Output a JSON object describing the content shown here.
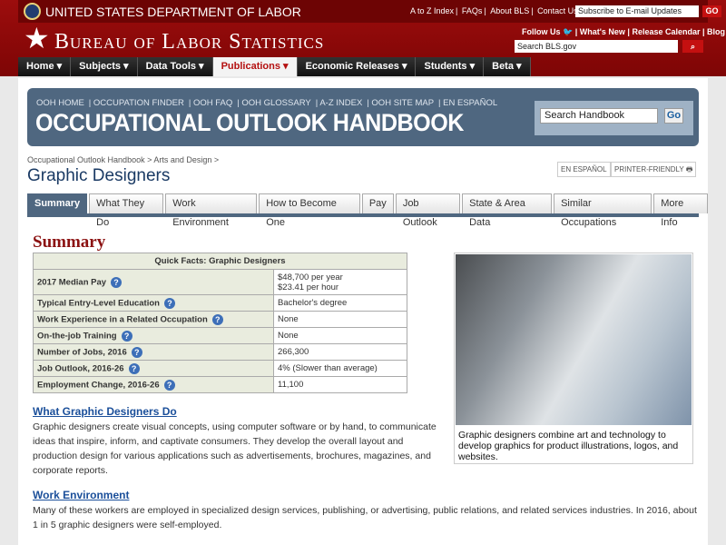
{
  "header": {
    "dol": "UNITED STATES DEPARTMENT OF LABOR",
    "top_links": [
      "A to Z Index",
      "FAQs",
      "About BLS",
      "Contact Us"
    ],
    "subscribe_placeholder": "Subscribe to E-mail Updates",
    "go": "GO",
    "bls": "Bureau of Labor Statistics",
    "follow": "Follow Us",
    "secondary_links": [
      "What's New",
      "Release Calendar",
      "Blog"
    ],
    "search_placeholder": "Search BLS.gov"
  },
  "nav": [
    "Home",
    "Subjects",
    "Data Tools",
    "Publications",
    "Economic Releases",
    "Students",
    "Beta"
  ],
  "ooh": {
    "links": [
      "OOH HOME",
      "OCCUPATION FINDER",
      "OOH FAQ",
      "OOH GLOSSARY",
      "A-Z INDEX",
      "OOH SITE MAP",
      "EN ESPAÑOL"
    ],
    "title": "OCCUPATIONAL OUTLOOK HANDBOOK",
    "search_value": "Search Handbook",
    "go": "Go"
  },
  "breadcrumb": [
    "Occupational Outlook Handbook",
    "Arts and Design"
  ],
  "page_title": "Graphic Designers",
  "tools": {
    "espanol": "EN ESPAÑOL",
    "printer": "PRINTER-FRIENDLY"
  },
  "tabs": [
    "Summary",
    "What They Do",
    "Work Environment",
    "How to Become One",
    "Pay",
    "Job Outlook",
    "State & Area Data",
    "Similar Occupations",
    "More Info"
  ],
  "summary": {
    "heading": "Summary",
    "table_title": "Quick Facts: Graphic Designers",
    "rows": [
      {
        "label": "2017 Median Pay",
        "value": "$48,700 per year",
        "value2": "$23.41 per hour"
      },
      {
        "label": "Typical Entry-Level Education",
        "value": "Bachelor's degree"
      },
      {
        "label": "Work Experience in a Related Occupation",
        "value": "None"
      },
      {
        "label": "On-the-job Training",
        "value": "None"
      },
      {
        "label": "Number of Jobs, 2016",
        "value": "266,300"
      },
      {
        "label": "Job Outlook, 2016-26",
        "value": "4% (Slower than average)"
      },
      {
        "label": "Employment Change, 2016-26",
        "value": "11,100"
      }
    ],
    "caption": "Graphic designers combine art and technology to develop graphics for product illustrations, logos, and websites."
  },
  "sections": [
    {
      "title": "What Graphic Designers Do",
      "text": "Graphic designers create visual concepts, using computer software or by hand, to communicate ideas that inspire, inform, and captivate consumers. They develop the overall layout and production design for various applications such as advertisements, brochures, magazines, and corporate reports."
    },
    {
      "title": "Work Environment",
      "text": "Many of these workers are employed in specialized design services, publishing, or advertising, public relations, and related services industries. In 2016, about 1 in 5 graphic designers were self-employed."
    }
  ]
}
